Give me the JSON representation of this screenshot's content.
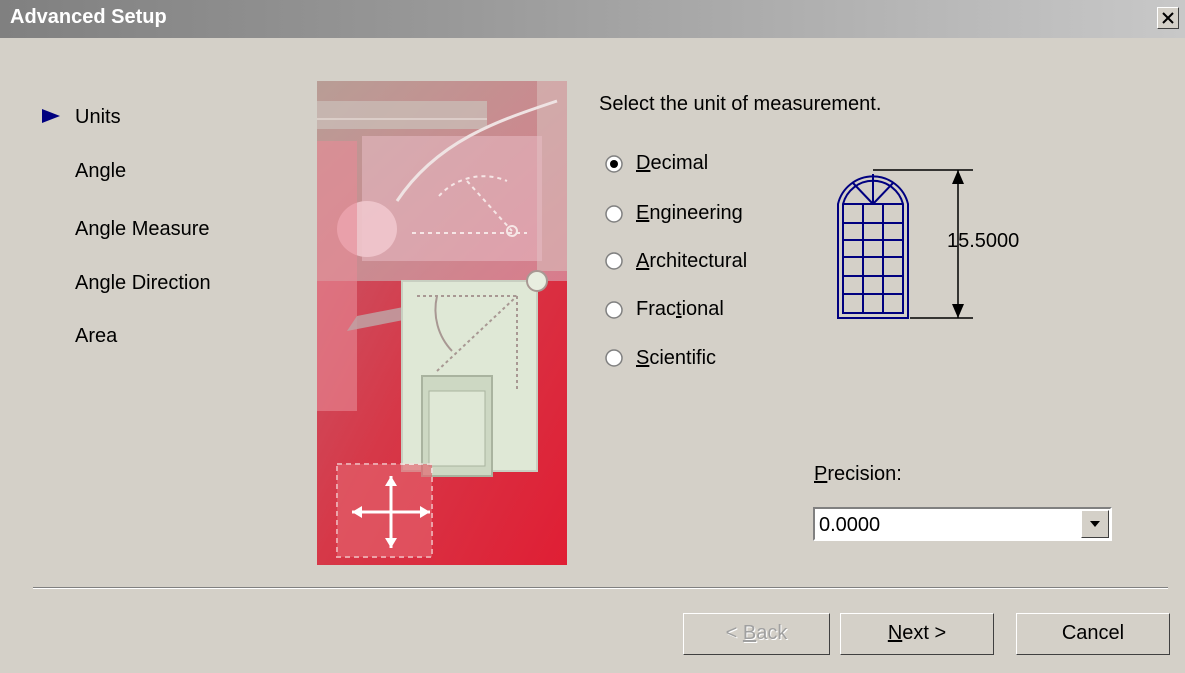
{
  "window": {
    "title": "Advanced Setup"
  },
  "steps": [
    "Units",
    "Angle",
    "Angle Measure",
    "Angle Direction",
    "Area"
  ],
  "current_step": "Units",
  "instruction": "Select the unit of measurement.",
  "units": {
    "options": [
      {
        "prefix": "",
        "accel": "D",
        "rest": "ecimal",
        "selected": true
      },
      {
        "prefix": "",
        "accel": "E",
        "rest": "ngineering",
        "selected": false
      },
      {
        "prefix": "",
        "accel": "A",
        "rest": "rchitectural",
        "selected": false
      },
      {
        "prefix": "Frac",
        "accel": "t",
        "rest": "ional",
        "selected": false
      },
      {
        "prefix": "",
        "accel": "S",
        "rest": "cientific",
        "selected": false
      }
    ]
  },
  "preview": {
    "dimension": "15.5000"
  },
  "precision": {
    "accel": "P",
    "rest": "recision:",
    "value": "0.0000"
  },
  "buttons": {
    "back": {
      "prefix": "< ",
      "accel": "B",
      "rest": "ack",
      "enabled": false
    },
    "next": {
      "prefix": "",
      "accel": "N",
      "rest": "ext >",
      "enabled": true
    },
    "cancel": {
      "label": "Cancel",
      "enabled": true
    }
  },
  "colors": {
    "face": "#d4d0c8",
    "accent_red": "#d9233a",
    "figure_blue": "#000080"
  },
  "icons": {
    "close": "close-icon",
    "current_step": "arrow-right-icon",
    "dropdown": "chevron-down-icon"
  }
}
